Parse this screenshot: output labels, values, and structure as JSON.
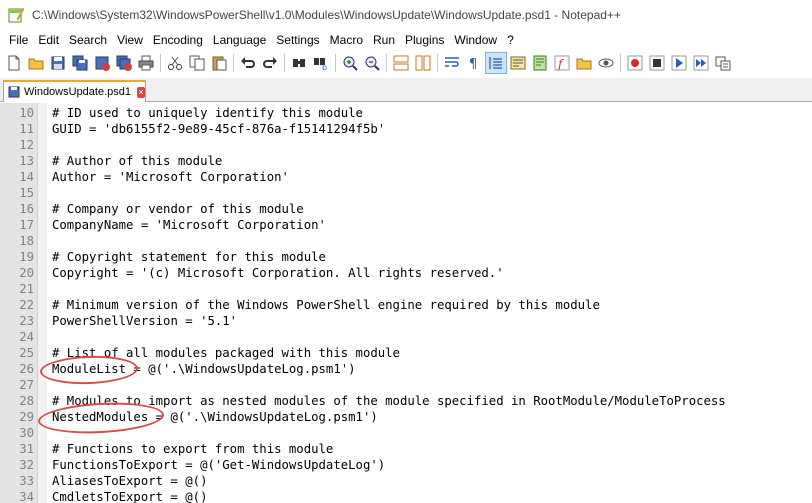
{
  "window": {
    "title": "C:\\Windows\\System32\\WindowsPowerShell\\v1.0\\Modules\\WindowsUpdate\\WindowsUpdate.psd1 - Notepad++"
  },
  "menu": [
    "File",
    "Edit",
    "Search",
    "View",
    "Encoding",
    "Language",
    "Settings",
    "Macro",
    "Run",
    "Plugins",
    "Window",
    "?"
  ],
  "toolbar": {
    "icons": [
      "new-file-icon",
      "open-file-icon",
      "save-icon",
      "save-all-icon",
      "close-icon",
      "close-all-icon",
      "print-icon",
      "cut-icon",
      "copy-icon",
      "paste-icon",
      "undo-icon",
      "redo-icon",
      "find-icon",
      "replace-icon",
      "zoom-in-icon",
      "zoom-out-icon",
      "sync-vertical-icon",
      "sync-horizontal-icon",
      "word-wrap-icon",
      "show-all-chars-icon",
      "indent-guide-icon",
      "udl-icon",
      "doc-map-icon",
      "function-list-icon",
      "folder-workspace-icon",
      "monitoring-icon",
      "record-macro-icon",
      "stop-macro-icon",
      "play-macro-icon",
      "run-macro-multiple-icon",
      "save-macro-icon"
    ]
  },
  "tab": {
    "label": "WindowsUpdate.psd1",
    "close": "×"
  },
  "editor": {
    "lines": [
      {
        "num": "10",
        "text": "# ID used to uniquely identify this module"
      },
      {
        "num": "11",
        "text": "GUID = 'db6155f2-9e89-45cf-876a-f15141294f5b'"
      },
      {
        "num": "12",
        "text": ""
      },
      {
        "num": "13",
        "text": "# Author of this module"
      },
      {
        "num": "14",
        "text": "Author = 'Microsoft Corporation'"
      },
      {
        "num": "15",
        "text": ""
      },
      {
        "num": "16",
        "text": "# Company or vendor of this module"
      },
      {
        "num": "17",
        "text": "CompanyName = 'Microsoft Corporation'"
      },
      {
        "num": "18",
        "text": ""
      },
      {
        "num": "19",
        "text": "# Copyright statement for this module"
      },
      {
        "num": "20",
        "text": "Copyright = '(c) Microsoft Corporation. All rights reserved.'"
      },
      {
        "num": "21",
        "text": ""
      },
      {
        "num": "22",
        "text": "# Minimum version of the Windows PowerShell engine required by this module"
      },
      {
        "num": "23",
        "text": "PowerShellVersion = '5.1'"
      },
      {
        "num": "24",
        "text": ""
      },
      {
        "num": "25",
        "text": "# List of all modules packaged with this module"
      },
      {
        "num": "26",
        "text": "ModuleList = @('.\\WindowsUpdateLog.psm1')"
      },
      {
        "num": "27",
        "text": ""
      },
      {
        "num": "28",
        "text": "# Modules to import as nested modules of the module specified in RootModule/ModuleToProcess"
      },
      {
        "num": "29",
        "text": "NestedModules = @('.\\WindowsUpdateLog.psm1')"
      },
      {
        "num": "30",
        "text": ""
      },
      {
        "num": "31",
        "text": "# Functions to export from this module"
      },
      {
        "num": "32",
        "text": "FunctionsToExport = @('Get-WindowsUpdateLog')"
      },
      {
        "num": "33",
        "text": "AliasesToExport = @()"
      },
      {
        "num": "34",
        "text": "CmdletsToExport = @()"
      }
    ]
  },
  "colors": {
    "annotation": "#d94c4c",
    "tab_accent": "#f5a623",
    "gutter": "#e4e4e4"
  }
}
